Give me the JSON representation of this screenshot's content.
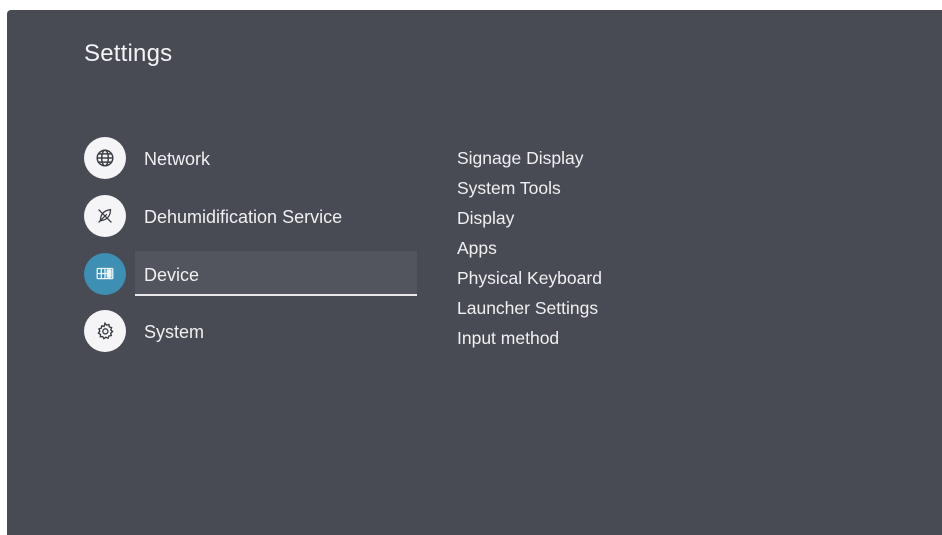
{
  "header": {
    "title": "Settings"
  },
  "menu": {
    "items": [
      {
        "label": "Network",
        "icon": "globe-icon",
        "selected": false
      },
      {
        "label": "Dehumidification Service",
        "icon": "eco-leaf-slash-icon",
        "selected": false
      },
      {
        "label": "Device",
        "icon": "device-display-icon",
        "selected": true
      },
      {
        "label": "System",
        "icon": "gear-icon",
        "selected": false
      }
    ]
  },
  "submenu": {
    "items": [
      "Signage Display",
      "System Tools",
      "Display",
      "Apps",
      "Physical Keyboard",
      "Launcher Settings",
      "Input method"
    ]
  },
  "colors": {
    "background": "#484a54",
    "accent": "#3d8fb3",
    "selection": "#52545e",
    "text": "#f0f0f2"
  }
}
